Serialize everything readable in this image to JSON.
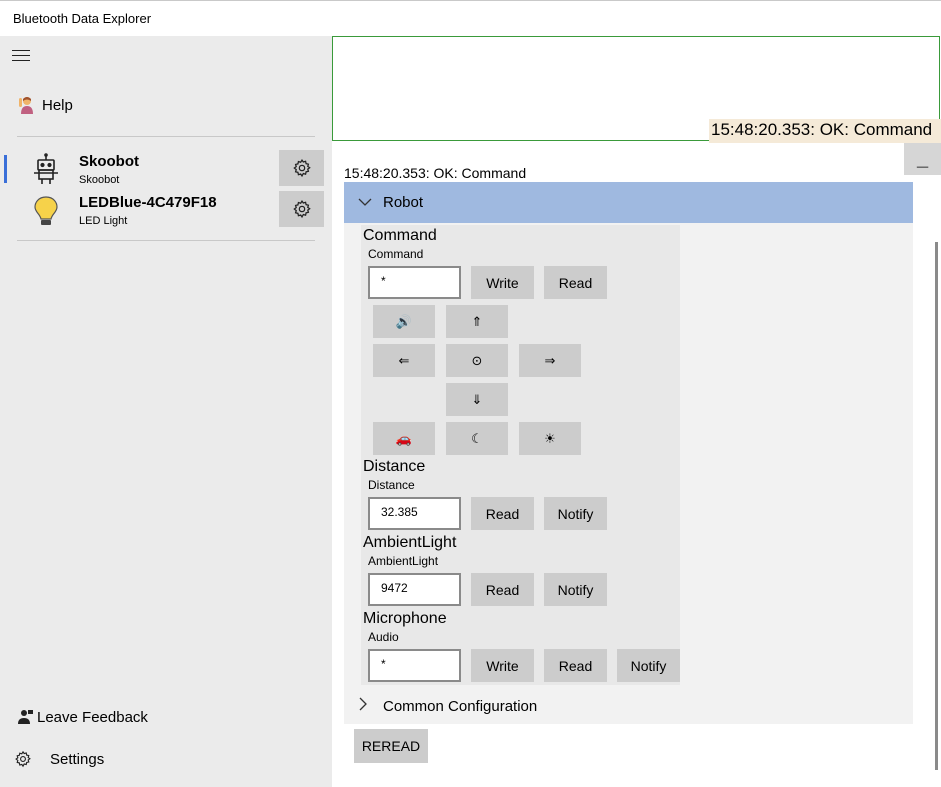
{
  "window": {
    "title": "Bluetooth Data Explorer"
  },
  "sidebar": {
    "help": {
      "label": "Help",
      "icon": "person-raising-hand-icon"
    },
    "devices": [
      {
        "name": "Skoobot",
        "subtitle": "Skoobot",
        "icon": "robot-icon",
        "selected": true
      },
      {
        "name": "LEDBlue-4C479F18",
        "subtitle": "LED Light",
        "icon": "lightbulb-icon",
        "selected": false
      }
    ],
    "leave_feedback": {
      "label": "Leave Feedback",
      "icon": "feedback-icon"
    },
    "settings": {
      "label": "Settings",
      "icon": "gear-icon"
    }
  },
  "log": {
    "last_line": "15:48:20.353: OK: Command",
    "minimize_label": "_"
  },
  "status_text": "15:48:20.353: OK: Command",
  "service": {
    "name": "Robot",
    "characteristics": {
      "command": {
        "title": "Command",
        "subtitle": "Command",
        "value": "*",
        "write_label": "Write",
        "read_label": "Read",
        "commands": {
          "speaker": "🔊",
          "up": "⇑",
          "left": "⇐",
          "stop": "⊙",
          "right": "⇒",
          "down": "⇓",
          "car": "🚗",
          "rover": "☾",
          "light": "☀"
        }
      },
      "distance": {
        "title": "Distance",
        "subtitle": "Distance",
        "value": "32.385",
        "read_label": "Read",
        "notify_label": "Notify"
      },
      "ambient_light": {
        "title": "AmbientLight",
        "subtitle": "AmbientLight",
        "value": "9472",
        "read_label": "Read",
        "notify_label": "Notify"
      },
      "microphone": {
        "title": "Microphone",
        "subtitle": "Audio",
        "value": "*",
        "write_label": "Write",
        "read_label": "Read",
        "notify_label": "Notify"
      }
    }
  },
  "common_configuration": {
    "label": "Common Configuration"
  },
  "reread_label": "REREAD",
  "colors": {
    "sidebar_bg": "#ebebeb",
    "section_header_bg": "#9fb9e0",
    "button_bg": "#cccccc",
    "log_border": "#3a9a3a",
    "log_highlight": "#f5ead8",
    "selection_accent": "#3a6fd8"
  }
}
